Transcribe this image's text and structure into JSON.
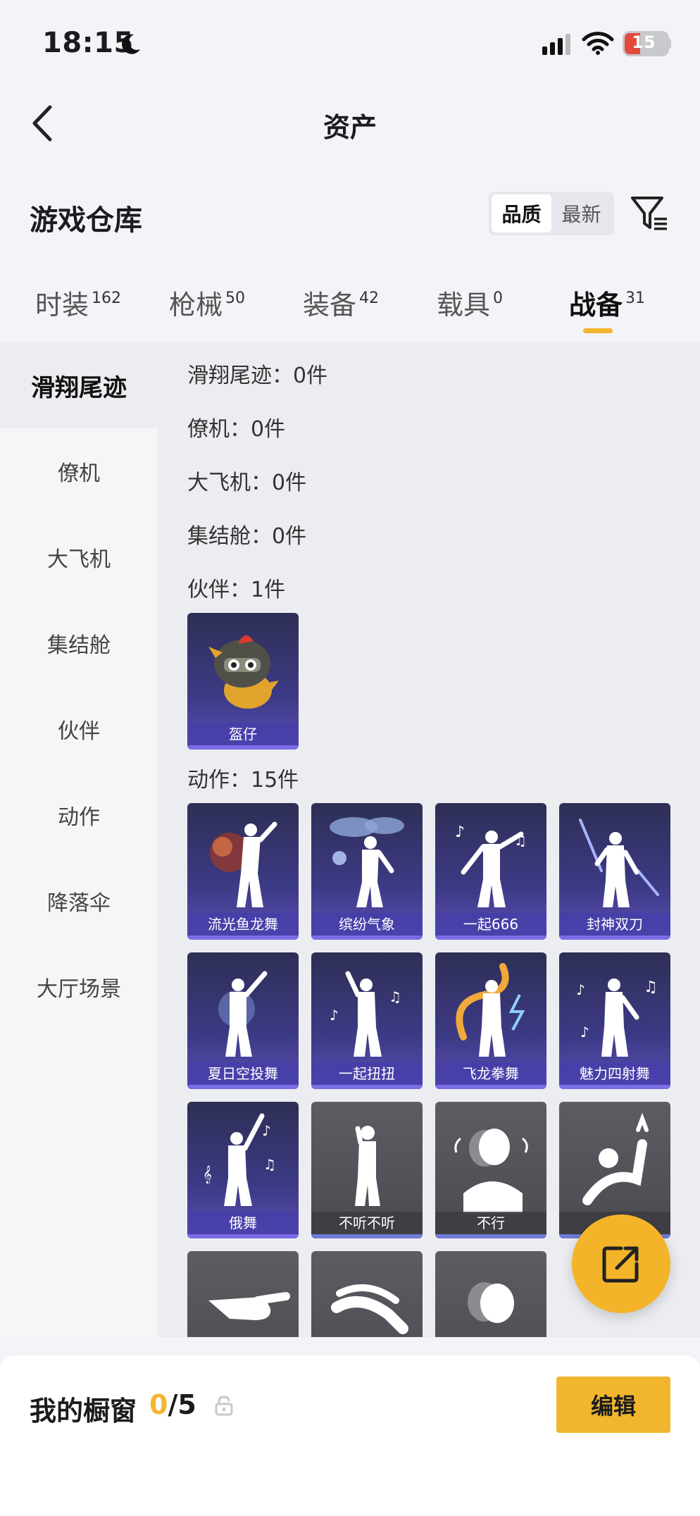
{
  "status": {
    "time": "18:15",
    "battery": "15"
  },
  "nav": {
    "title": "资产"
  },
  "warehouse": {
    "title": "游戏仓库",
    "sort_options": [
      "品质",
      "最新"
    ]
  },
  "tabs": [
    {
      "label": "时装",
      "count": "162"
    },
    {
      "label": "枪械",
      "count": "50"
    },
    {
      "label": "装备",
      "count": "42"
    },
    {
      "label": "载具",
      "count": "0"
    },
    {
      "label": "战备",
      "count": "31"
    }
  ],
  "sidebar": {
    "items": [
      "滑翔尾迹",
      "僚机",
      "大飞机",
      "集结舱",
      "伙伴",
      "动作",
      "降落伞",
      "大厅场景"
    ]
  },
  "sections": {
    "glide": "滑翔尾迹：0件",
    "wingman": "僚机：0件",
    "plane": "大飞机：0件",
    "pod": "集结舱：0件",
    "partner": "伙伴：1件",
    "emote": "动作：15件"
  },
  "partner_items": [
    {
      "name": "盔仔"
    }
  ],
  "emote_items": [
    {
      "name": "流光鱼龙舞"
    },
    {
      "name": "缤纷气象"
    },
    {
      "name": "一起666"
    },
    {
      "name": "封神双刀"
    },
    {
      "name": "夏日空投舞"
    },
    {
      "name": "一起扭扭"
    },
    {
      "name": "飞龙拳舞"
    },
    {
      "name": "魅力四射舞"
    },
    {
      "name": "俄舞"
    },
    {
      "name": "不听不听"
    },
    {
      "name": "不行"
    },
    {
      "name": ""
    }
  ],
  "showcase": {
    "title": "我的橱窗",
    "current": "0",
    "total": "/5",
    "edit_label": "编辑"
  },
  "colors": {
    "accent": "#f2b62e",
    "card_purple": "#3d3a86",
    "card_gray": "#4a4a51"
  }
}
